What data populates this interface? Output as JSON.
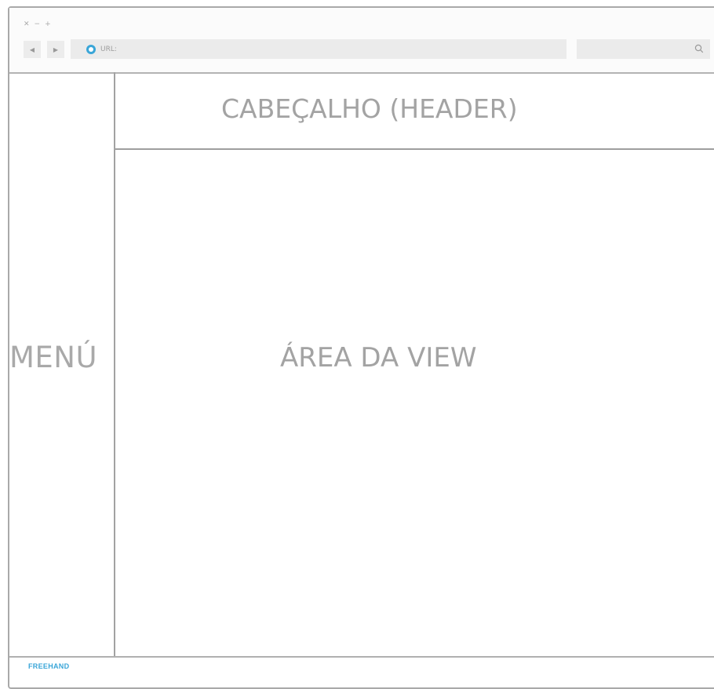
{
  "window": {
    "controls": [
      "✕",
      "−",
      "+"
    ]
  },
  "nav": {
    "back_icon": "◀",
    "forward_icon": "▶"
  },
  "url_bar": {
    "label": "URL:"
  },
  "search": {
    "icon": "search-icon"
  },
  "layout": {
    "menu_label": "MENÚ",
    "header_label": "CABEÇALHO (HEADER)",
    "view_label": "ÁREA DA VIEW"
  },
  "footer": {
    "brand": "FREEHAND"
  },
  "colors": {
    "accent": "#3aa6d8",
    "border": "#a9a9a9",
    "text": "#a3a3a3"
  }
}
